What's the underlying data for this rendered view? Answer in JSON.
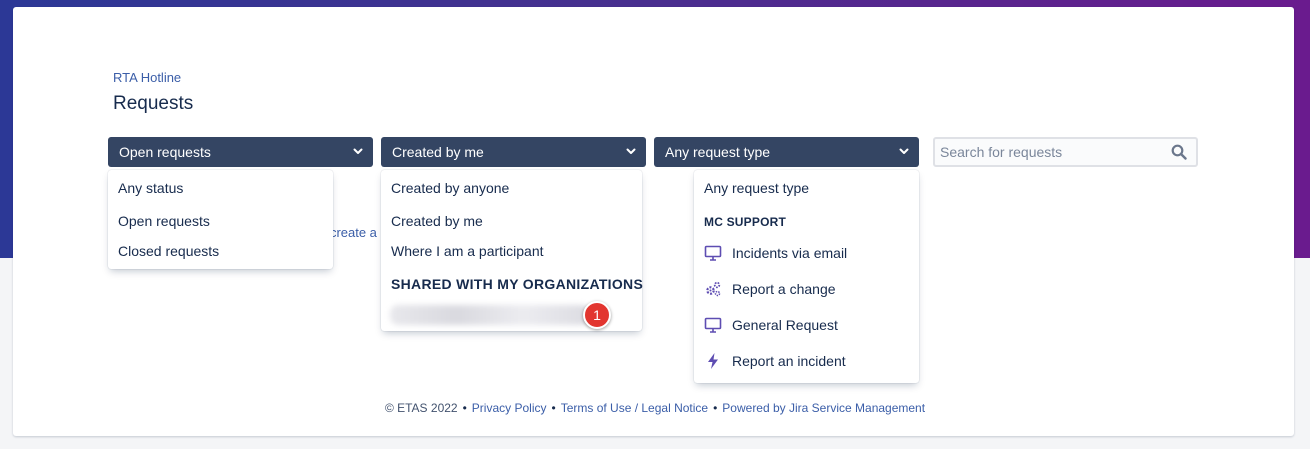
{
  "breadcrumb": "RTA Hotline",
  "page_title": "Requests",
  "filters": {
    "status": {
      "selected": "Open requests",
      "options": [
        "Any status",
        "Open requests",
        "Closed requests"
      ]
    },
    "creator": {
      "selected": "Created by me",
      "options": [
        "Created by anyone",
        "Created by me",
        "Where I am a participant"
      ],
      "section_heading": "SHARED WITH MY ORGANIZATIONS"
    },
    "request_type": {
      "selected": "Any request type",
      "first_option": "Any request type",
      "section_heading": "MC SUPPORT",
      "items": [
        {
          "label": "Incidents via email",
          "icon": "monitor-icon"
        },
        {
          "label": "Report a change",
          "icon": "gears-icon"
        },
        {
          "label": "General Request",
          "icon": "monitor-icon"
        },
        {
          "label": "Report an incident",
          "icon": "lightning-icon"
        }
      ]
    }
  },
  "search": {
    "placeholder": "Search for requests"
  },
  "background_link_fragment": "r  create a",
  "annotation_badge": "1",
  "footer": {
    "copyright": "© ETAS 2022",
    "privacy": "Privacy Policy",
    "terms": "Terms of Use / Legal Notice",
    "powered": "Powered by Jira Service Management"
  },
  "colors": {
    "banner_start": "#2c3896",
    "banner_end": "#6a1b8e",
    "filter_bg": "#344563",
    "link": "#3b5ea8",
    "icon_purple": "#5e4db2",
    "badge": "#e2352f"
  }
}
